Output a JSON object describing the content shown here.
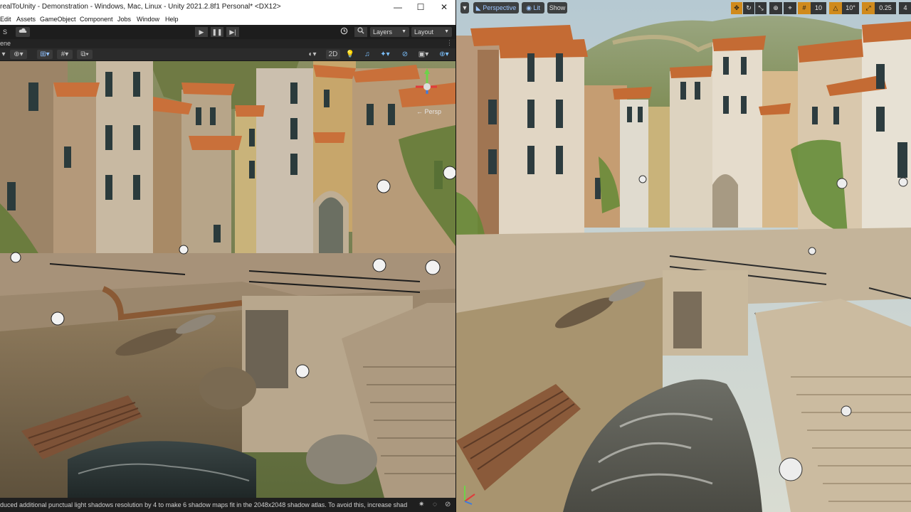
{
  "unity": {
    "window_title": "realToUnity - Demonstration - Windows, Mac, Linux - Unity 2021.2.8f1 Personal* <DX12>",
    "window_controls": {
      "minimize": "—",
      "maximize": "☐",
      "close": "✕"
    },
    "menu": [
      "Edit",
      "Assets",
      "GameObject",
      "Component",
      "Jobs",
      "Window",
      "Help"
    ],
    "toolbar": {
      "account_label": "S",
      "cloud_icon": "cloud-icon",
      "play_icon": "▶",
      "pause_icon": "❚❚",
      "step_icon": "▶|",
      "history_icon": "history-icon",
      "search_icon": "search-icon",
      "layers_label": "Layers",
      "layout_label": "Layout"
    },
    "tab_label": "ene",
    "scene_toolbar": {
      "toggle_2d": "2D",
      "persp_label": "← Persp"
    },
    "status_message": "duced additional punctual light shadows resolution by 4 to make 6 shadow maps fit in the 2048x2048 shadow atlas. To avoid this, increase shad"
  },
  "unreal": {
    "perspective_label": "Perspective",
    "lit_label": "Lit",
    "show_label": "Show",
    "grid_snap_value": "10",
    "rotation_snap_value": "10°",
    "scale_snap_value": "0.25",
    "camera_speed_value": "4"
  },
  "colors": {
    "unity_dark": "#282828",
    "unity_titlebar": "#ffffff",
    "unreal_snap_active": "#d08a1c",
    "unreal_blue_text": "#9dc6ff",
    "roof_terracotta": "#c9703a",
    "water": "#3d4a4a",
    "stone": "#b9a688"
  }
}
